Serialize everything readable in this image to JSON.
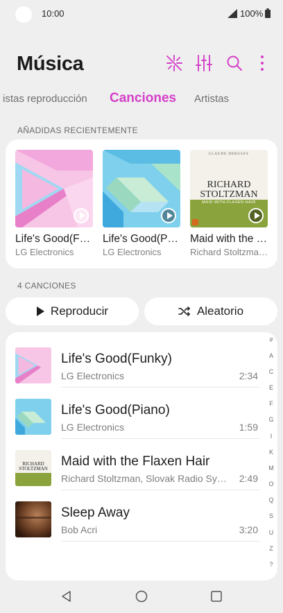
{
  "status": {
    "time": "10:00",
    "battery": "100%"
  },
  "header": {
    "title": "Música",
    "icons": [
      "party-lights-icon",
      "equalizer-icon",
      "search-icon",
      "more-vert-icon"
    ]
  },
  "tabs": [
    {
      "label": "istas reproducción",
      "active": false
    },
    {
      "label": "Canciones",
      "active": true
    },
    {
      "label": "Artistas",
      "active": false
    }
  ],
  "recent": {
    "label": "AÑADIDAS RECIENTEMENTE",
    "albums": [
      {
        "title": "Life's Good(Funky)",
        "artist": "LG Electronics"
      },
      {
        "title": "Life's Good(Piano)",
        "artist": "LG Electronics"
      },
      {
        "title": "Maid with the Flaxen Hair",
        "artist": "Richard Stoltzman, Slovak Radio Symphony Orchestra",
        "cover_line1": "RICHARD",
        "cover_line2": "STOLTZMAN",
        "cover_sub": "MAID WITH FLAXEN HAIR",
        "cover_top": "CLAUDE DEBUSSY"
      }
    ]
  },
  "songs_section": {
    "count_label": "4 CANCIONES",
    "play_label": "Reproducir",
    "shuffle_label": "Aleatorio"
  },
  "songs": [
    {
      "title": "Life's Good(Funky)",
      "artist": "LG Electronics",
      "duration": "2:34"
    },
    {
      "title": "Life's Good(Piano)",
      "artist": "LG Electronics",
      "duration": "1:59"
    },
    {
      "title": "Maid with the Flaxen Hair",
      "artist": "Richard Stoltzman, Slovak Radio Symphony Orchestra",
      "duration": "2:49",
      "cover_line1": "RICHARD",
      "cover_line2": "STOLTZMAN"
    },
    {
      "title": "Sleep Away",
      "artist": "Bob Acri",
      "duration": "3:20"
    }
  ],
  "index_letters": [
    "#",
    "A",
    "C",
    "E",
    "F",
    "G",
    "I",
    "K",
    "M",
    "O",
    "Q",
    "S",
    "U",
    "Z",
    "?"
  ],
  "colors": {
    "accent": "#d43fc8",
    "background": "#efefef",
    "card": "#ffffff"
  }
}
